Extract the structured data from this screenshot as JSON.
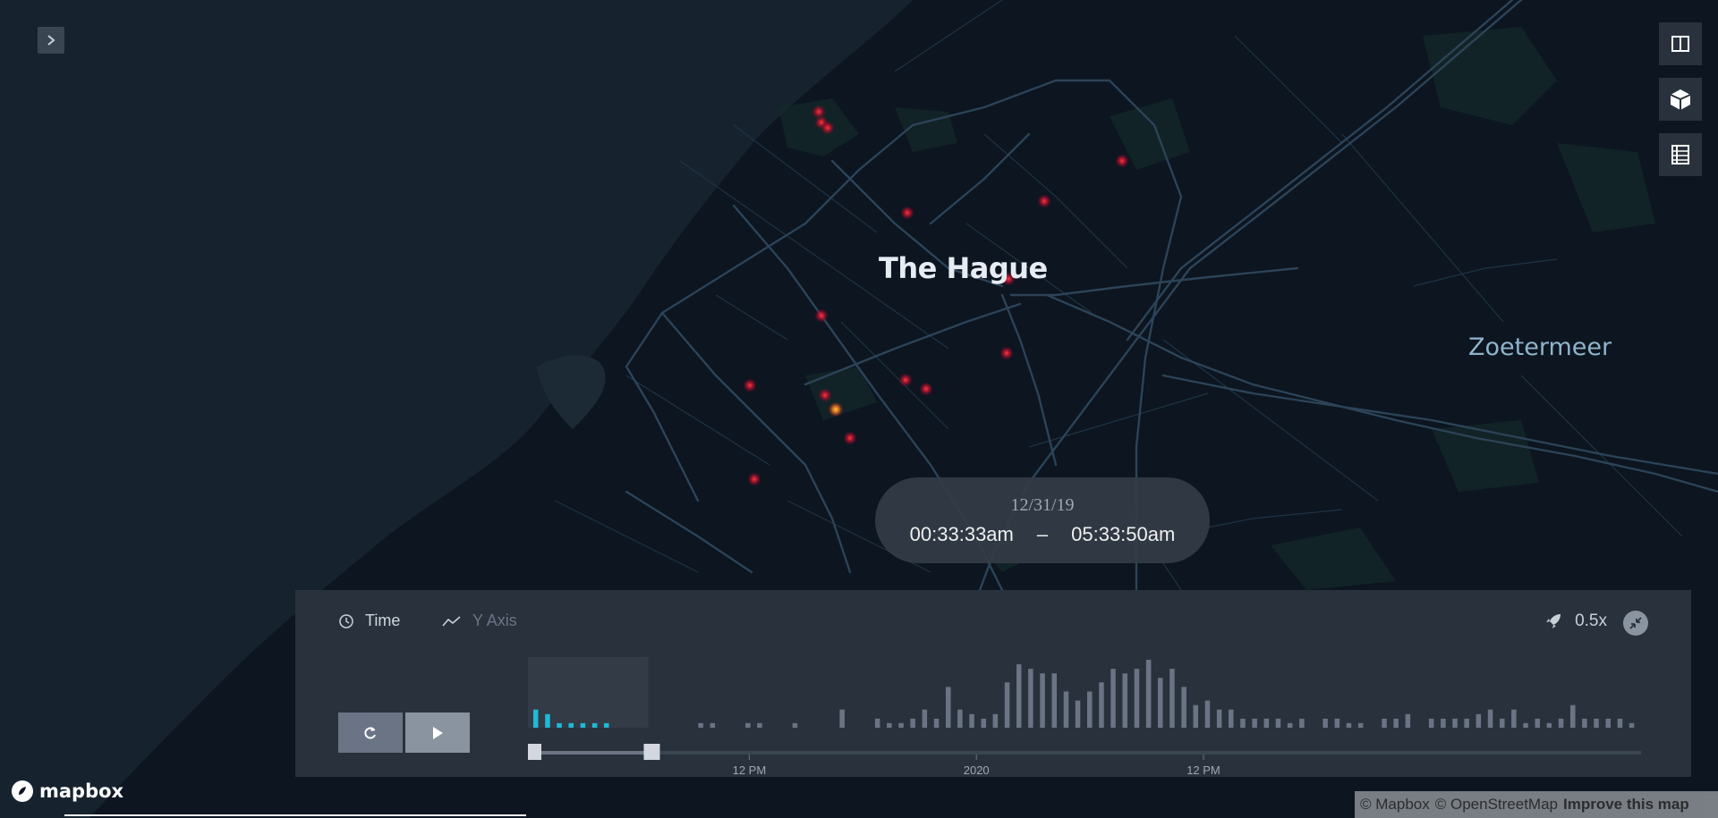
{
  "map": {
    "colors": {
      "land": "#0c1520",
      "sea": "#16232f",
      "roads": "#2c4358"
    },
    "city_labels": {
      "main": "The Hague",
      "secondary": "Zoetermeer"
    }
  },
  "time_display": {
    "date": "12/31/19",
    "start": "00:33:33am",
    "separator": "–",
    "end": "05:33:50am"
  },
  "timeline": {
    "tabs": [
      {
        "label": "Time",
        "icon": "clock-icon",
        "active": true
      },
      {
        "label": "Y Axis",
        "icon": "line-chart-icon",
        "active": false
      }
    ],
    "speed_label": "0.5x",
    "tick_labels": [
      "12 PM",
      "2020",
      "12 PM"
    ],
    "histogram_counts": [
      4,
      3,
      1,
      1,
      1,
      1,
      1,
      0,
      0,
      0,
      0,
      0,
      0,
      0,
      1,
      1,
      0,
      0,
      1,
      1,
      0,
      0,
      1,
      0,
      0,
      0,
      4,
      0,
      0,
      2,
      1,
      1,
      2,
      4,
      2,
      9,
      4,
      3,
      2,
      3,
      10,
      14,
      13,
      12,
      12,
      8,
      6,
      8,
      10,
      13,
      12,
      13,
      15,
      11,
      13,
      9,
      5,
      6,
      4,
      4,
      2,
      2,
      2,
      2,
      1,
      2,
      0,
      2,
      2,
      1,
      1,
      0,
      2,
      2,
      3,
      0,
      2,
      2,
      2,
      2,
      3,
      4,
      2,
      4,
      1,
      2,
      1,
      2,
      5,
      2,
      2,
      2,
      2,
      1
    ],
    "selection_fraction": [
      0.0,
      0.107
    ]
  },
  "attribution": {
    "logo_text": "mapbox",
    "parts": [
      "© Mapbox",
      "© OpenStreetMap",
      "Improve this map"
    ]
  },
  "tools": [
    "split-map-icon",
    "3d-view-icon",
    "legend-icon"
  ]
}
